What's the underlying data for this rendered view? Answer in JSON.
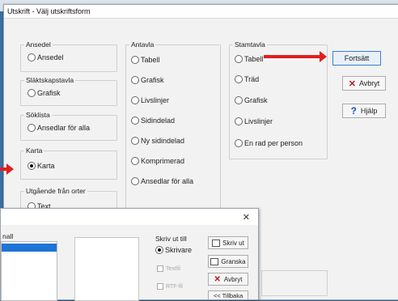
{
  "window": {
    "title": "Utskrift - Välj utskriftsform"
  },
  "groups": {
    "ansedel": {
      "legend": "Ansedel",
      "options": [
        "Ansedel"
      ]
    },
    "slaktskapstavla": {
      "legend": "Släktskapstavla",
      "options": [
        "Grafisk"
      ]
    },
    "soklista": {
      "legend": "Söklista",
      "options": [
        "Ansedlar för alla"
      ]
    },
    "karta": {
      "legend": "Karta",
      "options": [
        "Karta"
      ]
    },
    "utgaende": {
      "legend": "Utgående från orter",
      "options": [
        "Text"
      ]
    },
    "antavla": {
      "legend": "Antavla",
      "options": [
        "Tabell",
        "Grafisk",
        "Livslinjer",
        "Sidindelad",
        "Ny sidindelad",
        "Komprimerad",
        "Ansedlar för alla"
      ]
    },
    "stamtavla": {
      "legend": "Stamtavla",
      "options": [
        "Tabell",
        "Träd",
        "Grafisk",
        "Livslinjer",
        "En rad per person"
      ]
    }
  },
  "buttons": {
    "fortsatt": "Fortsätt",
    "avbryt": "Avbryt",
    "hjalp": "Hjälp"
  },
  "dialog2": {
    "list_header": "nall",
    "skriv_ut_till": "Skriv ut till",
    "dest_options": [
      "Skrivare",
      "Textfil",
      "RTF-fil"
    ],
    "buttons": [
      "Skriv ut",
      "Granska",
      "Avbryt",
      "<< Tillbaka"
    ],
    "close_glyph": "✕"
  },
  "colors": {
    "arrow": "#e01f1f",
    "primary_border": "#3c7fd1",
    "list_selection": "#1e73d6"
  }
}
